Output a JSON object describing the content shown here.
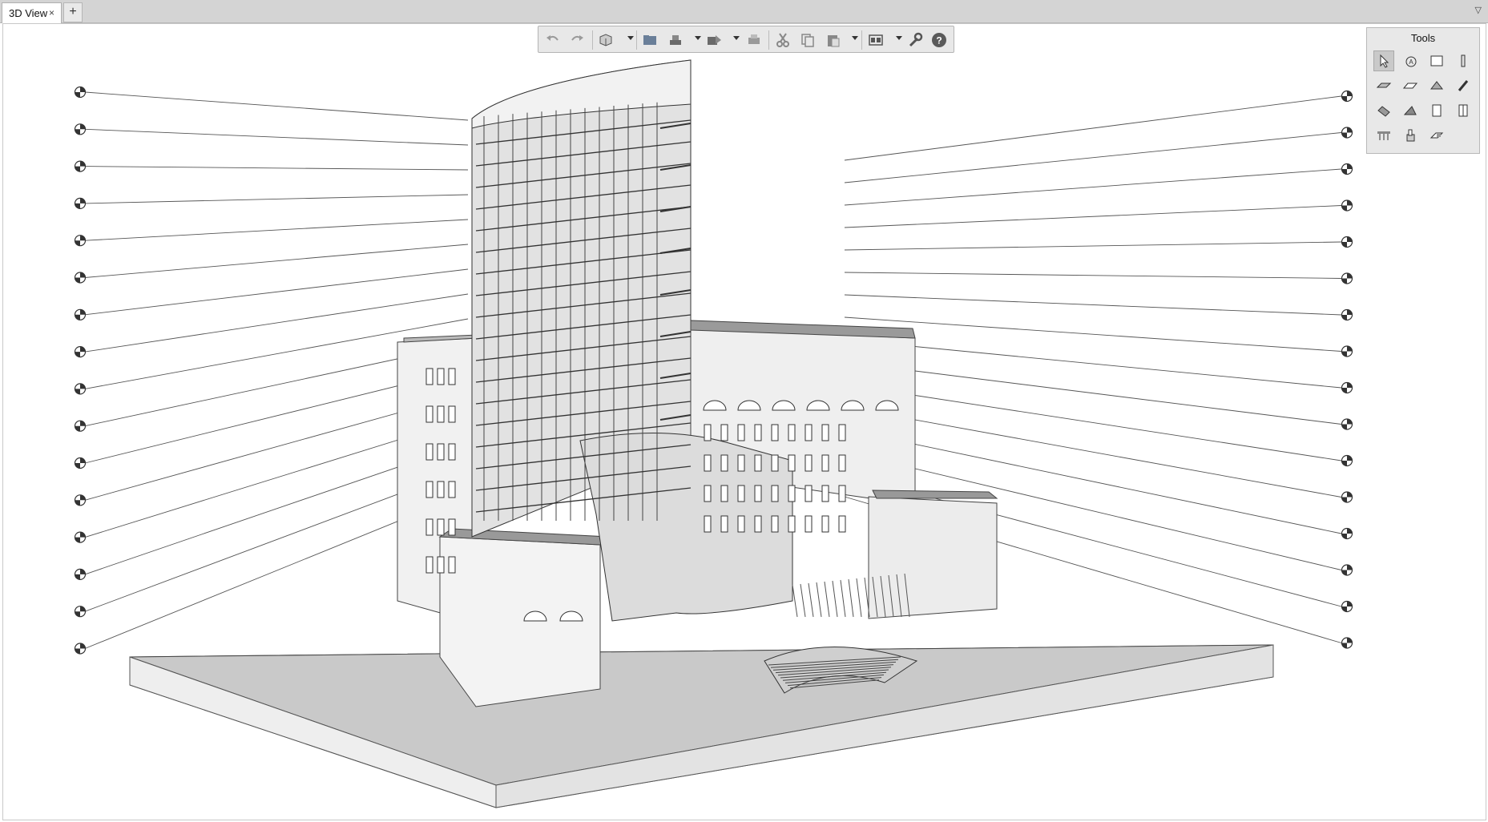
{
  "tabs": {
    "active_label": "3D View",
    "close_glyph": "×",
    "add_glyph": "+",
    "menu_glyph": "▽"
  },
  "toolbar": {
    "items": [
      "undo-icon",
      "redo-icon",
      "3d-view-icon",
      "open-icon",
      "save-icon",
      "export-icon",
      "print-icon",
      "cut-icon",
      "copy-icon",
      "paste-icon",
      "layers-icon",
      "settings-wrench-icon",
      "help-icon"
    ]
  },
  "tools_panel": {
    "title": "Tools",
    "items": [
      "select-arrow-icon",
      "label-tool-icon",
      "wall-tool-icon",
      "column-tool-icon",
      "slab-tool-icon",
      "roof-tool-icon",
      "shell-tool-icon",
      "beam-tool-icon",
      "stair-tool-icon",
      "ramp-tool-icon",
      "door-tool-icon",
      "window-tool-icon",
      "railing-tool-icon",
      "object-tool-icon",
      "zone-tool-icon"
    ]
  },
  "colors": {
    "tabbar": "#d4d4d4",
    "panel": "#e8e8e8",
    "line": "#4a4a4a",
    "ground": "#cdcdcd"
  }
}
